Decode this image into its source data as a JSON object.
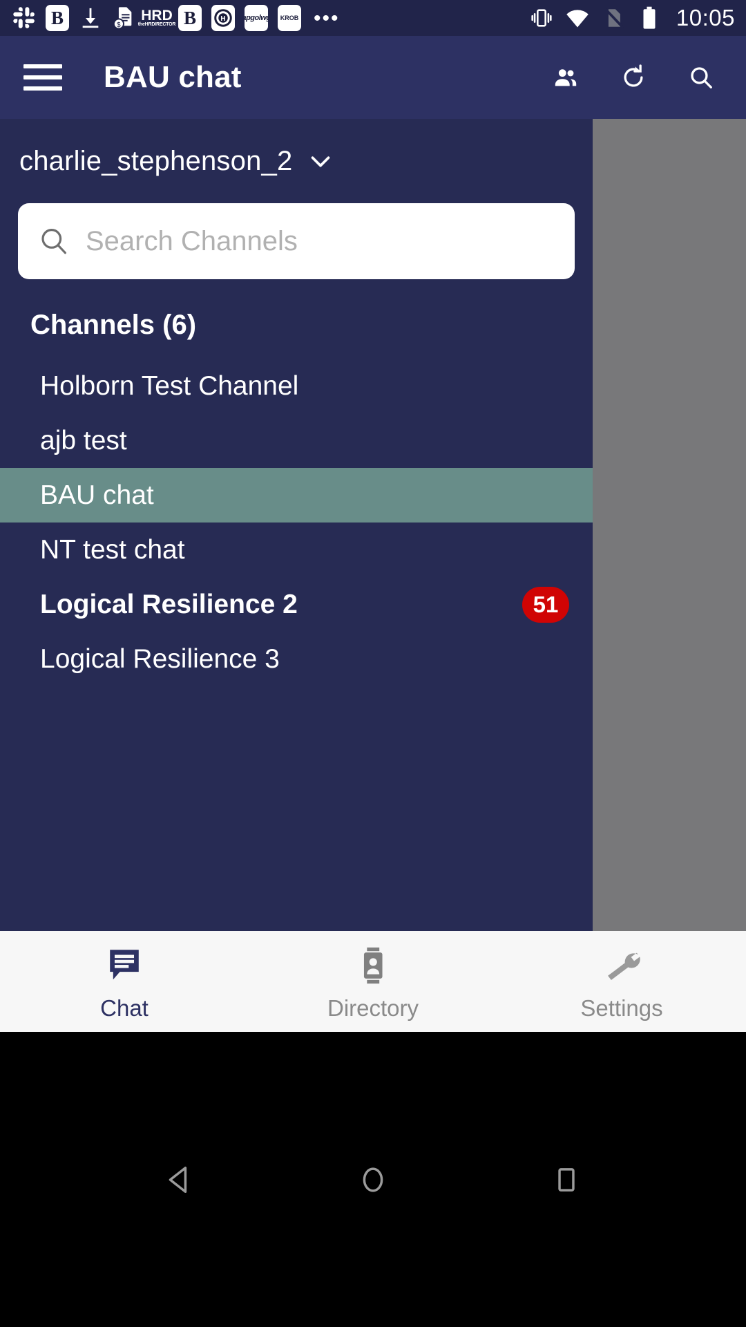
{
  "status_bar": {
    "time": "10:05",
    "notification_icons": [
      {
        "name": "slack-icon",
        "glyph": ""
      },
      {
        "name": "app-b-icon",
        "glyph": "B"
      },
      {
        "name": "download-icon",
        "glyph": ""
      },
      {
        "name": "invoice-icon",
        "glyph": ""
      },
      {
        "name": "hrd-icon",
        "glyph": "HRD"
      },
      {
        "name": "app-b2-icon",
        "glyph": "B"
      },
      {
        "name": "holborn-h-icon",
        "glyph": "H"
      },
      {
        "name": "apgolwg-icon",
        "glyph": "apgolwg"
      },
      {
        "name": "krob-icon",
        "glyph": "KROB"
      }
    ],
    "overflow": "•••",
    "system_icons": [
      "vibrate-icon",
      "wifi-icon",
      "no-sim-icon",
      "battery-icon"
    ]
  },
  "app_bar": {
    "menu_label": "menu",
    "title": "BAU chat",
    "actions": [
      {
        "name": "people-icon",
        "label": "People"
      },
      {
        "name": "refresh-icon",
        "label": "Refresh"
      },
      {
        "name": "search-icon",
        "label": "Search"
      }
    ]
  },
  "drawer": {
    "account": {
      "name": "charlie_stephenson_2",
      "chevron": "chevron-down-icon"
    },
    "search": {
      "placeholder": "Search Channels",
      "value": ""
    },
    "channels_header": "Channels (6)",
    "channels": [
      {
        "label": "Holborn Test Channel",
        "selected": false,
        "unread": false,
        "badge": ""
      },
      {
        "label": "ajb test",
        "selected": false,
        "unread": false,
        "badge": ""
      },
      {
        "label": "BAU chat",
        "selected": true,
        "unread": false,
        "badge": ""
      },
      {
        "label": "NT test chat",
        "selected": false,
        "unread": false,
        "badge": ""
      },
      {
        "label": "Logical Resilience 2",
        "selected": false,
        "unread": true,
        "badge": "51"
      },
      {
        "label": "Logical Resilience 3",
        "selected": false,
        "unread": false,
        "badge": ""
      }
    ]
  },
  "tab_bar": {
    "tabs": [
      {
        "label": "Chat",
        "icon": "chat-bubble-icon",
        "active": true
      },
      {
        "label": "Directory",
        "icon": "contact-card-icon",
        "active": false
      },
      {
        "label": "Settings",
        "icon": "wrench-icon",
        "active": false
      }
    ]
  },
  "nav_bar": {
    "back": "back-triangle-icon",
    "home": "home-circle-icon",
    "recents": "recents-square-icon"
  },
  "colors": {
    "status_bar_bg": "#21244a",
    "app_bar_bg": "#2d3163",
    "drawer_bg": "#272b54",
    "selected_channel_bg": "#688d89",
    "badge_red": "#d00404",
    "tab_bar_bg": "#f7f7f7",
    "tab_active": "#2d3163",
    "tab_inactive": "#8a8a8a",
    "scrim_gray": "#78787a"
  }
}
